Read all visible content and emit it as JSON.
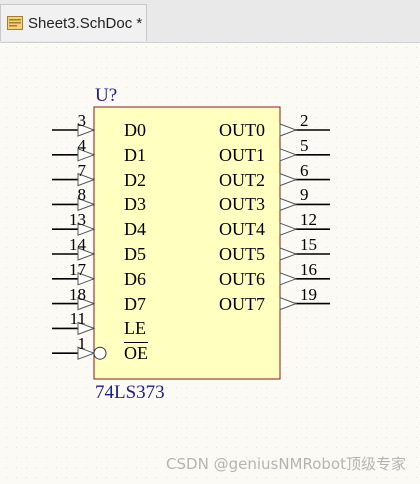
{
  "tab": {
    "label": "Sheet3.SchDoc *"
  },
  "component": {
    "designator": "U?",
    "comment": "74LS373",
    "body_fill": "#ffffc0",
    "body_stroke": "#8b1a1a",
    "left_pins": [
      {
        "num": "3",
        "name": "D0"
      },
      {
        "num": "4",
        "name": "D1"
      },
      {
        "num": "7",
        "name": "D2"
      },
      {
        "num": "8",
        "name": "D3"
      },
      {
        "num": "13",
        "name": "D4"
      },
      {
        "num": "14",
        "name": "D5"
      },
      {
        "num": "17",
        "name": "D6"
      },
      {
        "num": "18",
        "name": "D7"
      },
      {
        "num": "11",
        "name": "LE"
      },
      {
        "num": "1",
        "name": "OE"
      }
    ],
    "right_pins": [
      {
        "num": "2",
        "name": "OUT0"
      },
      {
        "num": "5",
        "name": "OUT1"
      },
      {
        "num": "6",
        "name": "OUT2"
      },
      {
        "num": "9",
        "name": "OUT3"
      },
      {
        "num": "12",
        "name": "OUT4"
      },
      {
        "num": "15",
        "name": "OUT5"
      },
      {
        "num": "16",
        "name": "OUT6"
      },
      {
        "num": "19",
        "name": "OUT7"
      }
    ]
  },
  "watermark": "CSDN @geniusNMRobot顶级专家"
}
